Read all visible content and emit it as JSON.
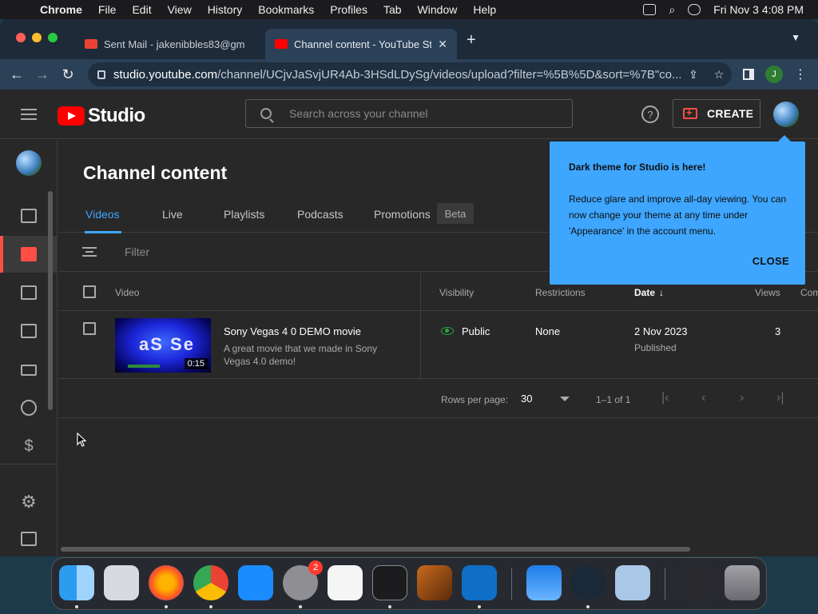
{
  "menubar": {
    "app": "Chrome",
    "items": [
      "File",
      "Edit",
      "View",
      "History",
      "Bookmarks",
      "Profiles",
      "Tab",
      "Window",
      "Help"
    ],
    "datetime": "Fri Nov 3  4:08 PM"
  },
  "browser": {
    "tabs": [
      {
        "title": "Sent Mail - jakenibbles83@gm",
        "favicon": "gmail-icon",
        "color": "#ea4335"
      },
      {
        "title": "Channel content - YouTube St",
        "favicon": "youtube-icon",
        "color": "#ff0000"
      }
    ],
    "url_host": "studio.youtube.com",
    "url_path": "/channel/UCjvJaSvjUR4Ab-3HSdLDySg/videos/upload?filter=%5B%5D&sort=%7B\"co...",
    "profile_initial": "J"
  },
  "studio": {
    "logo_text": "Studio",
    "search_placeholder": "Search across your channel",
    "create_label": "CREATE",
    "page_title": "Channel content",
    "tabs": [
      "Videos",
      "Live",
      "Playlists",
      "Podcasts",
      "Promotions"
    ],
    "beta_label": "Beta",
    "filter_placeholder": "Filter",
    "columns": {
      "video": "Video",
      "visibility": "Visibility",
      "restrictions": "Restrictions",
      "date": "Date",
      "views": "Views",
      "comments": "Com"
    },
    "rows": [
      {
        "title": "Sony Vegas 4 0 DEMO movie",
        "description": "A great movie that we made in Sony Vegas 4.0 demo!",
        "thumbnail_text": "aS Se",
        "duration": "0:15",
        "visibility": "Public",
        "restrictions": "None",
        "date": "2 Nov 2023",
        "date_status": "Published",
        "views": "3"
      }
    ],
    "pagination": {
      "rows_label": "Rows per page:",
      "rows_value": "30",
      "range": "1–1 of 1"
    },
    "popup": {
      "title": "Dark theme for Studio is here!",
      "body": "Reduce glare and improve all-day viewing. You can now change your theme at any time under 'Appearance' in the account menu.",
      "close_label": "CLOSE"
    }
  },
  "dock": {
    "settings_badge": "2"
  },
  "colors": {
    "accent_blue": "#3ea6ff",
    "youtube_red": "#ff0000",
    "public_green": "#2ba640"
  }
}
